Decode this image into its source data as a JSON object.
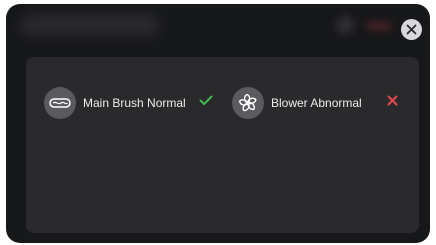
{
  "dialog": {
    "close_icon": "close-icon",
    "items": [
      {
        "label": "Main Brush Normal",
        "icon": "main-brush-icon",
        "status": "normal",
        "status_icon": "check-icon",
        "status_color": "#3fb950"
      },
      {
        "label": "Blower Abnormal",
        "icon": "fan-icon",
        "status": "abnormal",
        "status_icon": "cross-icon",
        "status_color": "#e5484d"
      }
    ]
  },
  "colors": {
    "modal_bg": "#17181a",
    "panel_bg": "#2a2a2c",
    "icon_circle": "#5b5b5f",
    "text": "#ececed"
  }
}
